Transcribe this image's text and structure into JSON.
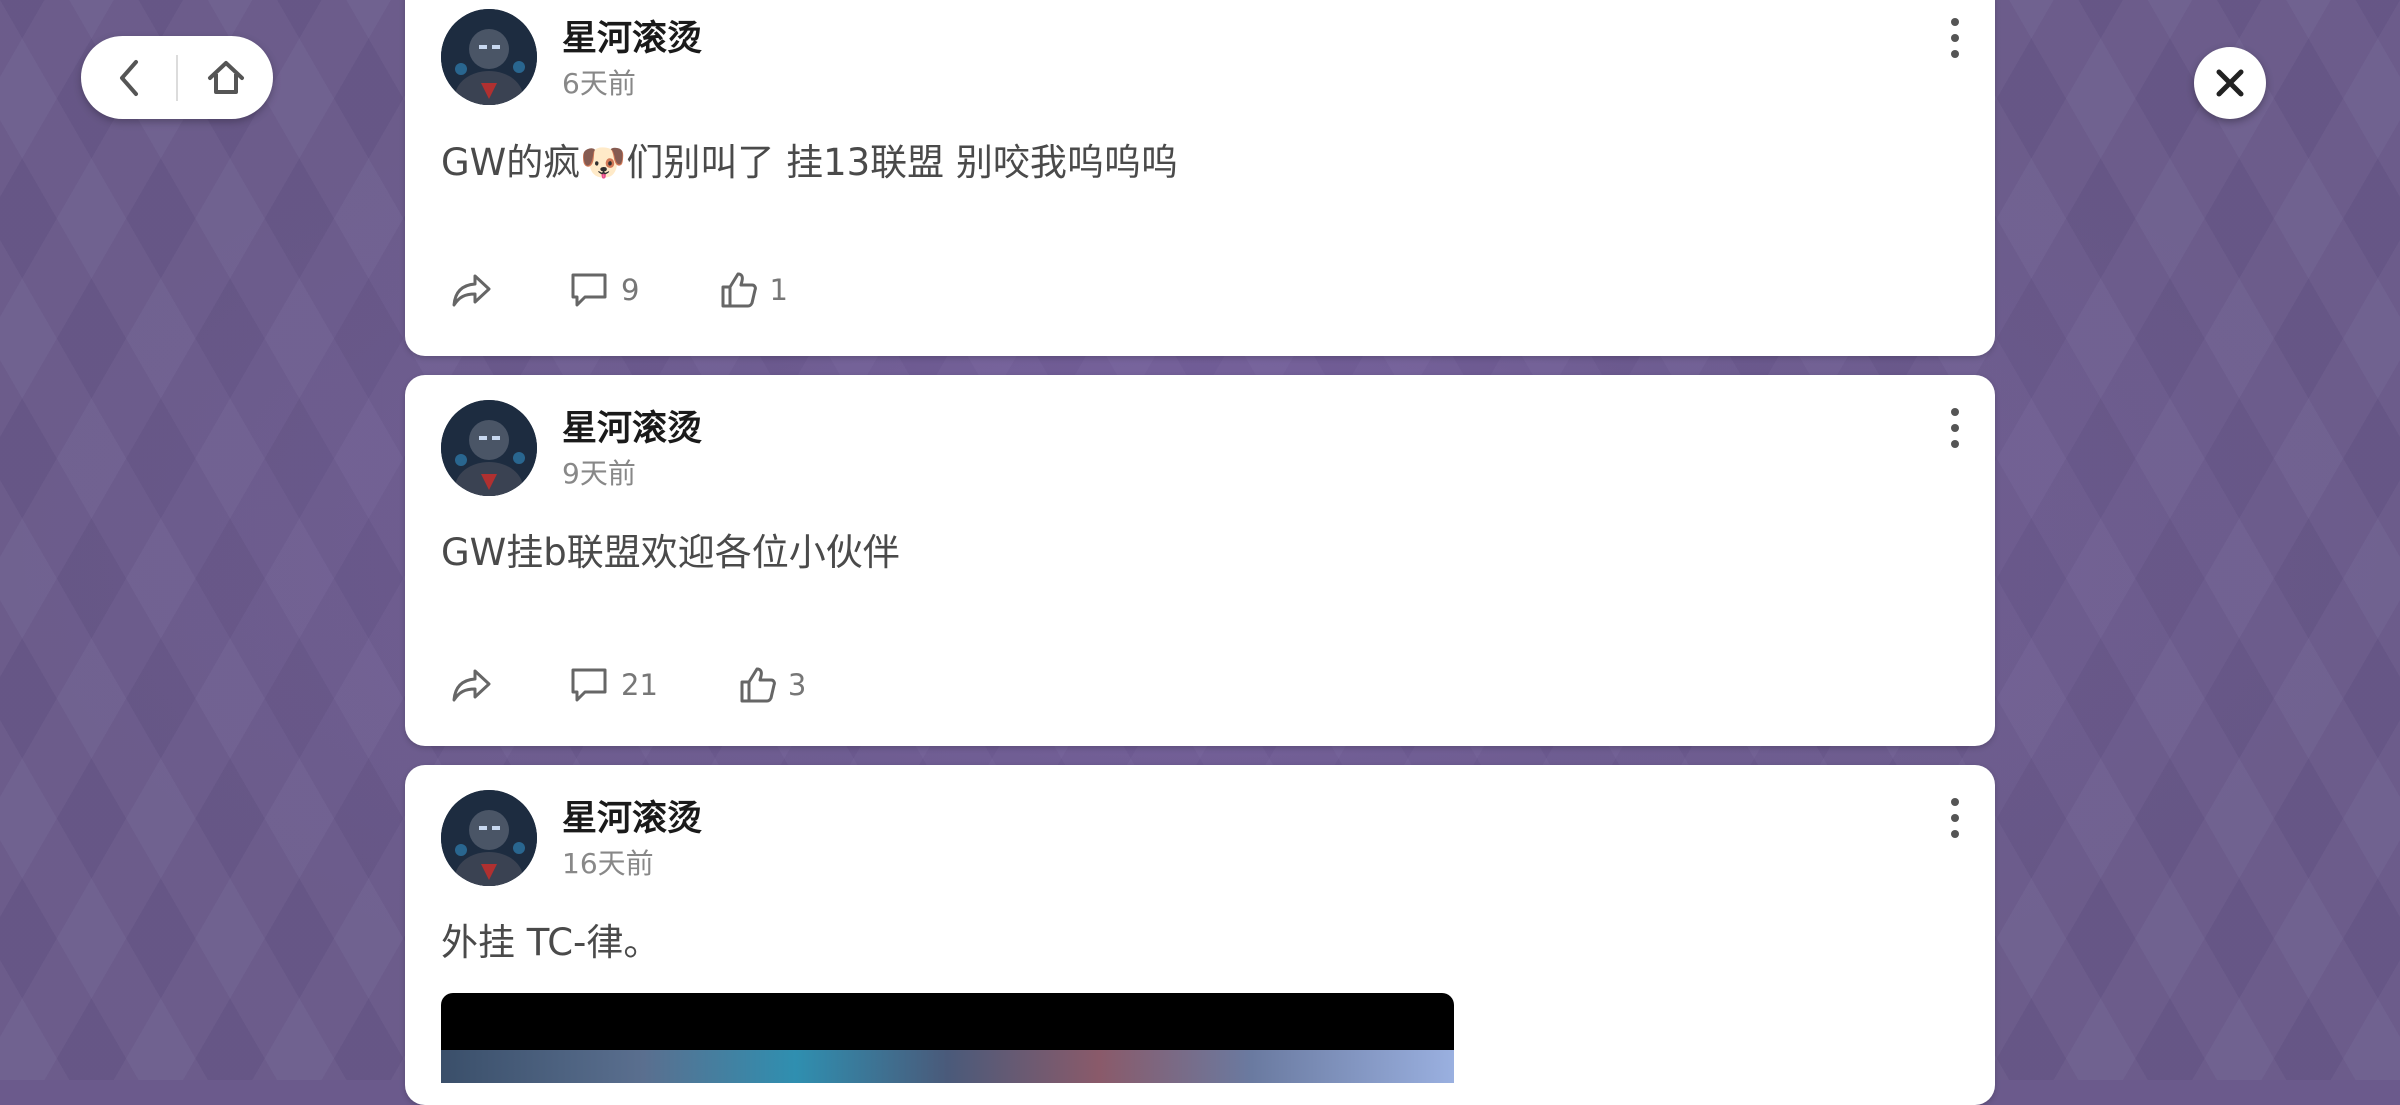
{
  "nav": {
    "back_icon": "chevron-left-icon",
    "home_icon": "home-icon",
    "close_icon": "close-icon"
  },
  "posts": [
    {
      "username": "星河滚烫",
      "time": "6天前",
      "content": "GW的疯🐶们别叫了 挂13联盟 别咬我呜呜呜",
      "comments": "9",
      "likes": "1"
    },
    {
      "username": "星河滚烫",
      "time": "9天前",
      "content": "GW挂b联盟欢迎各位小伙伴",
      "comments": "21",
      "likes": "3"
    },
    {
      "username": "星河滚烫",
      "time": "16天前",
      "content": "外挂 TC-律。",
      "has_media": true
    }
  ]
}
